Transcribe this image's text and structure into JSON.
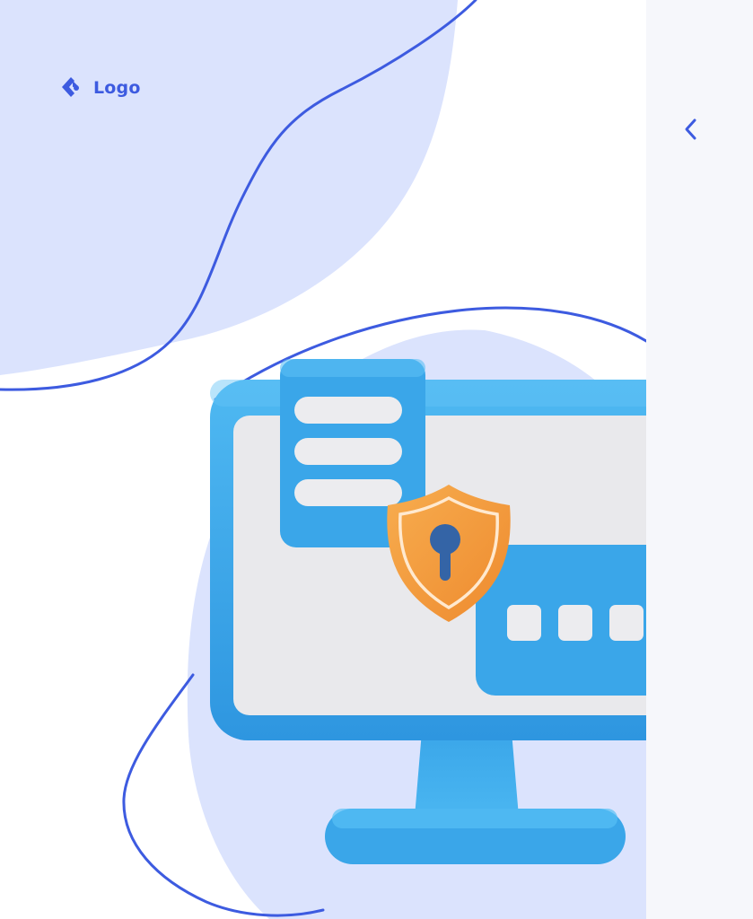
{
  "brand": {
    "logo_text": "Logo",
    "logo_icon": "logo-mark-icon"
  },
  "navigation": {
    "back_icon": "chevron-left-icon"
  },
  "illustration": {
    "subject": "monitor-security-icon",
    "shield_icon": "shield-keyhole-icon",
    "password_dots": 3,
    "list_lines": 3
  },
  "colors": {
    "accent": "#3d5be0",
    "blob": "#dbe3fd",
    "monitor": "#3aa6e9",
    "screen": "#e9e9ec",
    "shield": "#f39a3c",
    "side_panel": "#f6f7fb"
  }
}
